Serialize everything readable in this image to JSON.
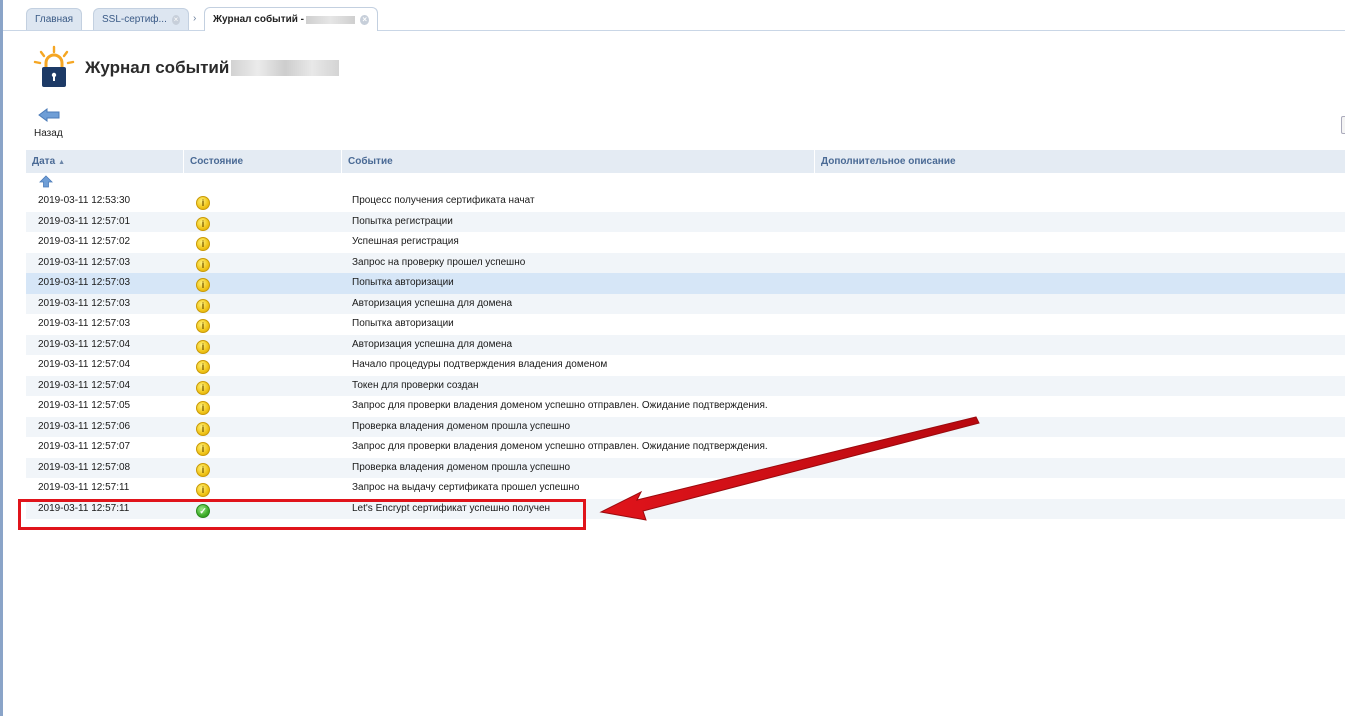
{
  "tabs": [
    {
      "label": "Главная"
    },
    {
      "label": "SSL-сертиф..."
    },
    {
      "label": "Журнал событий -"
    }
  ],
  "header": {
    "title": "Журнал событий -"
  },
  "toolbar": {
    "back_label": "Назад"
  },
  "table": {
    "columns": [
      "Дата",
      "Состояние",
      "Событие",
      "Дополнительное описание"
    ],
    "rows": [
      {
        "date": "2019-03-11 12:53:30",
        "status": "warning",
        "event": "Процесс получения сертификата начат"
      },
      {
        "date": "2019-03-11 12:57:01",
        "status": "warning",
        "event": "Попытка регистрации"
      },
      {
        "date": "2019-03-11 12:57:02",
        "status": "warning",
        "event": "Успешная регистрация"
      },
      {
        "date": "2019-03-11 12:57:03",
        "status": "warning",
        "event": "Запрос на проверку прошел успешно"
      },
      {
        "date": "2019-03-11 12:57:03",
        "status": "warning",
        "event": "Попытка авторизации",
        "selected": true
      },
      {
        "date": "2019-03-11 12:57:03",
        "status": "warning",
        "event": "Авторизация успешна для домена"
      },
      {
        "date": "2019-03-11 12:57:03",
        "status": "warning",
        "event": "Попытка авторизации"
      },
      {
        "date": "2019-03-11 12:57:04",
        "status": "warning",
        "event": "Авторизация успешна для домена"
      },
      {
        "date": "2019-03-11 12:57:04",
        "status": "warning",
        "event": "Начало процедуры подтверждения владения доменом"
      },
      {
        "date": "2019-03-11 12:57:04",
        "status": "warning",
        "event": "Токен для проверки создан"
      },
      {
        "date": "2019-03-11 12:57:05",
        "status": "warning",
        "event": "Запрос для проверки владения доменом успешно отправлен. Ожидание подтверждения."
      },
      {
        "date": "2019-03-11 12:57:06",
        "status": "warning",
        "event": "Проверка владения доменом прошла успешно"
      },
      {
        "date": "2019-03-11 12:57:07",
        "status": "warning",
        "event": "Запрос для проверки владения доменом успешно отправлен. Ожидание подтверждения."
      },
      {
        "date": "2019-03-11 12:57:08",
        "status": "warning",
        "event": "Проверка владения доменом прошла успешно"
      },
      {
        "date": "2019-03-11 12:57:11",
        "status": "warning",
        "event": "Запрос на выдачу сертификата прошел успешно"
      },
      {
        "date": "2019-03-11 12:57:11",
        "status": "ok",
        "event": "Let's Encrypt сертификат успешно получен"
      }
    ]
  },
  "colors": {
    "header_bg": "#e4ebf3",
    "header_text": "#4a6a95",
    "row_alt": "#f1f5f9",
    "row_selected": "#d6e6f7",
    "annotation": "#e0141b"
  }
}
